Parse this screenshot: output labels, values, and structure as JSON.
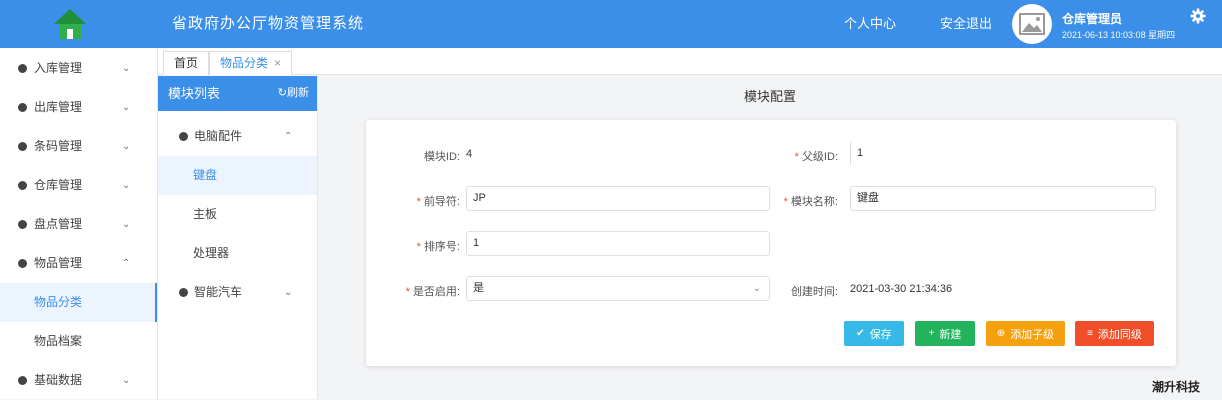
{
  "header": {
    "title": "省政府办公厅物资管理系统",
    "personal_center": "个人中心",
    "logout": "安全退出",
    "user_role": "仓库管理员",
    "datetime": "2021-06-13 10:03:08 星期四"
  },
  "sidebar": {
    "items": [
      {
        "label": "入库管理"
      },
      {
        "label": "出库管理"
      },
      {
        "label": "条码管理"
      },
      {
        "label": "仓库管理"
      },
      {
        "label": "盘点管理"
      },
      {
        "label": "物品管理"
      }
    ],
    "sub_items": [
      {
        "label": "物品分类"
      },
      {
        "label": "物品档案"
      }
    ],
    "bottom_item": {
      "label": "基础数据"
    }
  },
  "tabs": {
    "home": "首页",
    "active": "物品分类"
  },
  "module_list": {
    "title": "模块列表",
    "refresh": "刷新",
    "groups": [
      {
        "label": "电脑配件",
        "children": [
          "键盘",
          "主板",
          "处理器"
        ]
      },
      {
        "label": "智能汽车"
      }
    ]
  },
  "form": {
    "title": "模块配置",
    "module_id_label": "模块ID:",
    "module_id": "4",
    "parent_id_label": "父级ID:",
    "parent_id": "1",
    "prefix_label": "前导符:",
    "prefix": "JP",
    "name_label": "模块名称:",
    "name": "键盘",
    "sort_label": "排序号:",
    "sort": "1",
    "enabled_label": "是否启用:",
    "enabled": "是",
    "created_label": "创建时间:",
    "created": "2021-03-30 21:34:36",
    "save": "保存",
    "new": "新建",
    "add_child": "添加子级",
    "add_peer": "添加同级"
  },
  "footer": {
    "brand": "潮升科技"
  },
  "colors": {
    "accent": "#3b8fe8",
    "save": "#36b8e8",
    "new": "#22b35c",
    "child": "#f5a10f",
    "peer": "#ef4e29"
  }
}
